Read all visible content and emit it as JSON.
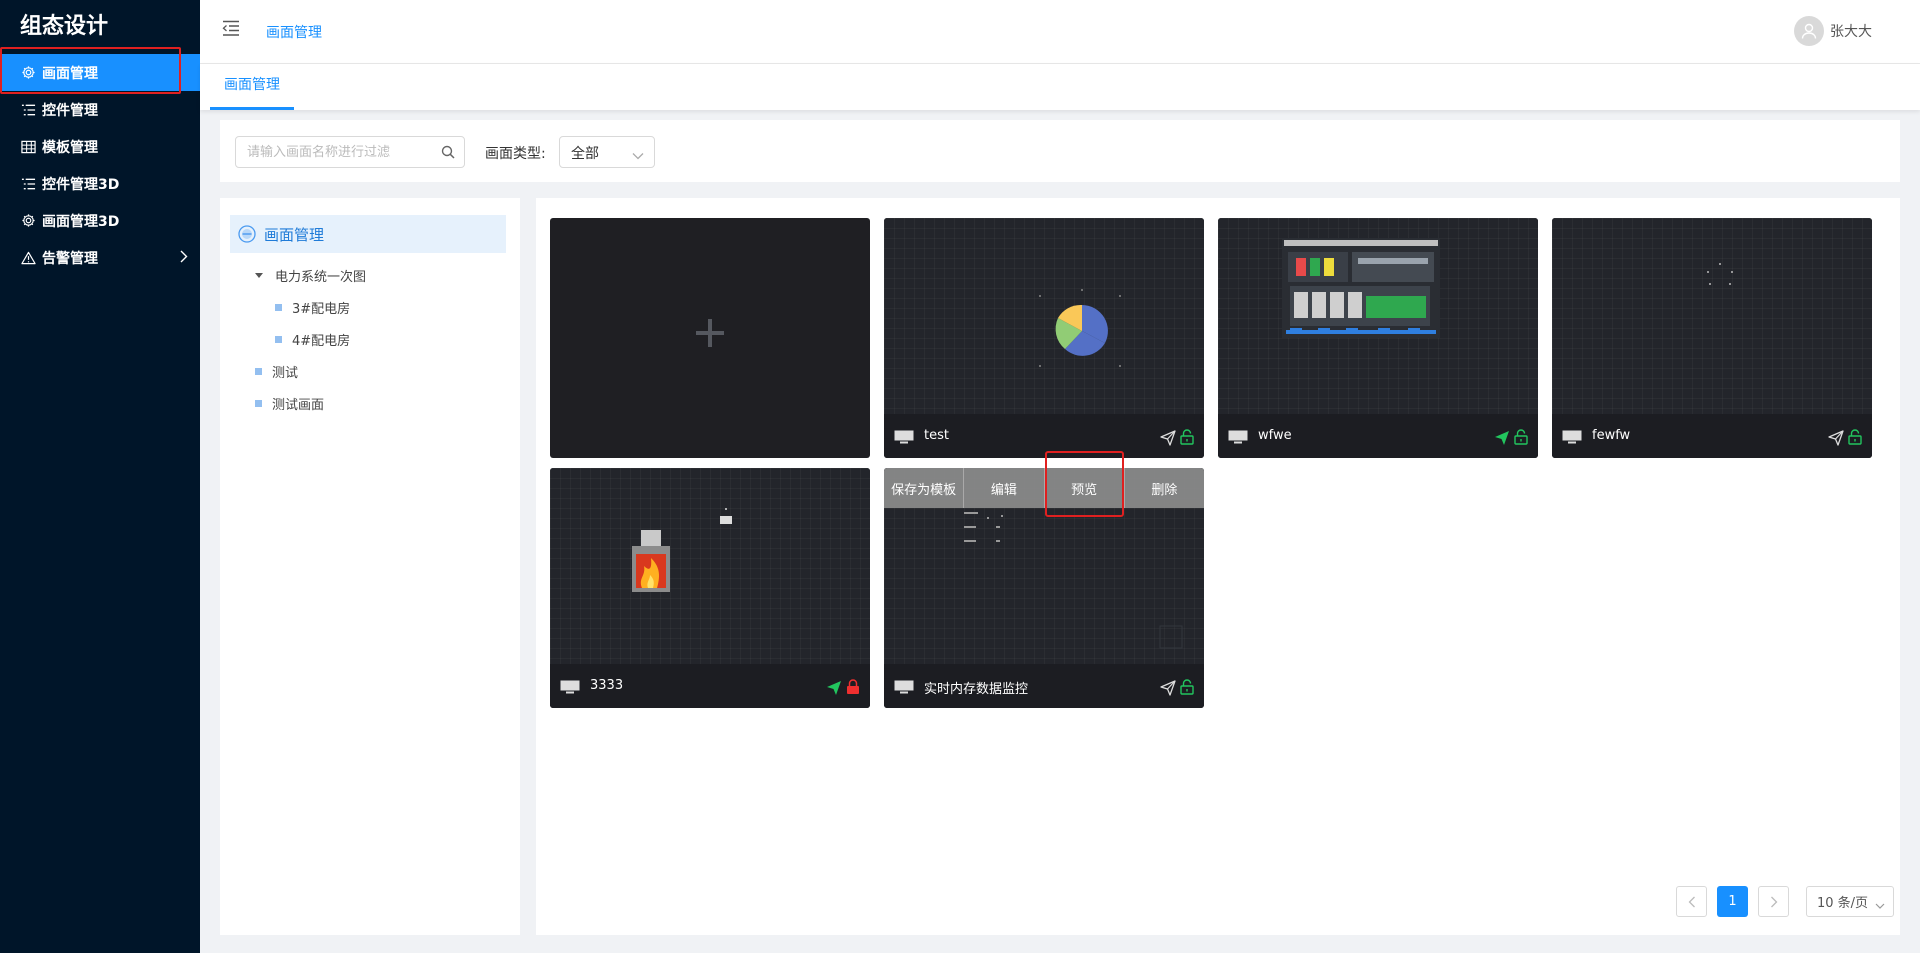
{
  "app": {
    "title": "组态设计"
  },
  "sidebar": {
    "items": [
      {
        "label": "画面管理",
        "icon": "gear-icon",
        "active": true
      },
      {
        "label": "控件管理",
        "icon": "list-icon"
      },
      {
        "label": "模板管理",
        "icon": "table-icon"
      },
      {
        "label": "控件管理3D",
        "icon": "list-icon"
      },
      {
        "label": "画面管理3D",
        "icon": "gear-icon"
      },
      {
        "label": "告警管理",
        "icon": "warning-icon",
        "has_children": true
      }
    ]
  },
  "header": {
    "breadcrumb": "画面管理",
    "user_name": "张大大"
  },
  "tabs": [
    {
      "label": "画面管理",
      "active": true
    }
  ],
  "filter": {
    "search_placeholder": "请输入画面名称进行过滤",
    "type_label": "画面类型:",
    "type_value": "全部"
  },
  "tree": {
    "root": "画面管理",
    "nodes": [
      {
        "label": "电力系统一次图",
        "expanded": true,
        "children": [
          {
            "label": "3#配电房"
          },
          {
            "label": "4#配电房"
          }
        ]
      },
      {
        "label": "测试"
      },
      {
        "label": "测试画面"
      }
    ]
  },
  "cards": [
    {
      "name": "test",
      "published": false,
      "locked": false
    },
    {
      "name": "wfwe",
      "published": true,
      "locked": false
    },
    {
      "name": "fewfw",
      "published": false,
      "locked": false
    },
    {
      "name": "3333",
      "published": true,
      "locked": true
    },
    {
      "name": "实时内存数据监控",
      "published": false,
      "locked": false
    }
  ],
  "card_actions": {
    "save_template": "保存为模板",
    "edit": "编辑",
    "preview": "预览",
    "delete": "删除"
  },
  "pagination": {
    "current": "1",
    "page_size": "10 条/页"
  },
  "colors": {
    "primary": "#1890ff",
    "sidebar_bg": "#001529",
    "published": "#22c55e",
    "unlocked": "#22c55e",
    "locked": "#ef2f2f",
    "highlight": "#e02020"
  }
}
